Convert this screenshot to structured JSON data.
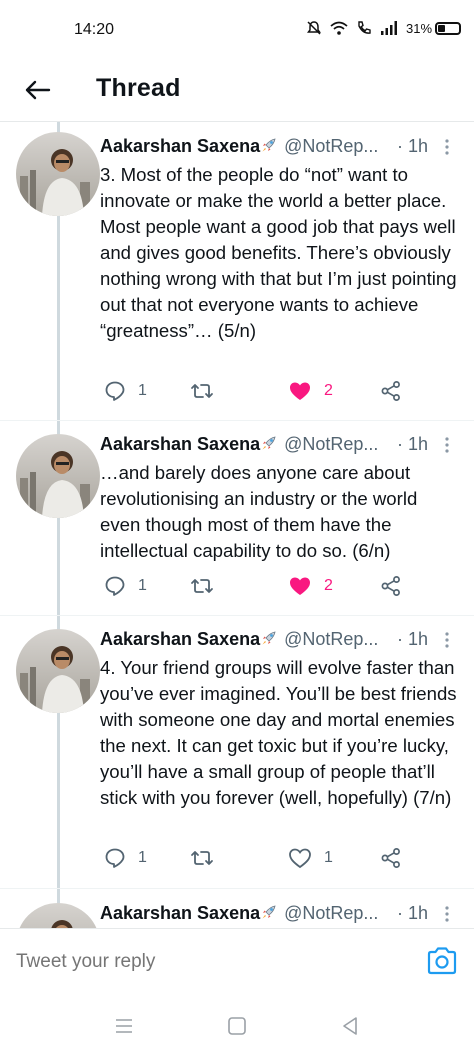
{
  "status_bar": {
    "time": "14:20",
    "battery": "31%",
    "icons": [
      "mute-icon",
      "wifi-icon",
      "call-icon",
      "signal-icon",
      "battery-icon"
    ]
  },
  "header": {
    "title": "Thread",
    "back_icon": "arrow-left-icon"
  },
  "tweets": [
    {
      "author": "Aakarshan Saxena",
      "handle": "@NotRep...",
      "time": "· 1h",
      "text": "3. Most of the people do “not” want to innovate or make the world a better place. Most people want a good job that pays well and gives good benefits. There’s obviously nothing wrong with that but I’m just pointing out that not everyone wants to achieve “greatness”… (5/n)",
      "replies": "1",
      "retweets": "",
      "likes": "2",
      "liked": true
    },
    {
      "author": "Aakarshan Saxena",
      "handle": "@NotRep...",
      "time": "· 1h",
      "text": "…and barely does anyone care about revolutionising an industry or the world even though most of them have the intellectual capability to do so. (6/n)",
      "replies": "1",
      "retweets": "",
      "likes": "2",
      "liked": true
    },
    {
      "author": "Aakarshan Saxena",
      "handle": "@NotRep...",
      "time": "· 1h",
      "text": "4. Your friend groups will evolve faster than you’ve ever imagined. You’ll be best friends with someone one day and mortal enemies the next. It can get toxic but if you’re lucky, you’ll have a small group of people that’ll stick with you forever (well, hopefully) (7/n)",
      "replies": "1",
      "retweets": "",
      "likes": "1",
      "liked": false
    },
    {
      "author": "Aakarshan Saxena",
      "handle": "@NotRep...",
      "time": "· 1h"
    }
  ],
  "reply_bar": {
    "placeholder": "Tweet your reply",
    "camera_icon": "camera-icon"
  },
  "colors": {
    "text": "#0f1419",
    "muted": "#536471",
    "like": "#f91880",
    "accent": "#1d9bf0",
    "thread_line": "#cfd9de"
  }
}
